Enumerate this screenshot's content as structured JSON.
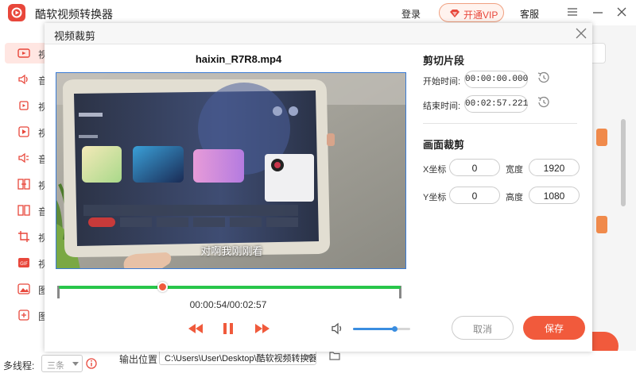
{
  "app": {
    "title": "酷软视频转换器",
    "login": "登录",
    "vip": "开通VIP",
    "service": "客服"
  },
  "sidebar": {
    "items": [
      {
        "label": "视",
        "icon": "video-icon"
      },
      {
        "label": "音",
        "icon": "audio-icon"
      },
      {
        "label": "视",
        "icon": "video-rotate-icon"
      },
      {
        "label": "视",
        "icon": "video-edit-icon"
      },
      {
        "label": "音",
        "icon": "audio-edit-icon"
      },
      {
        "label": "视",
        "icon": "merge-icon"
      },
      {
        "label": "音",
        "icon": "audio-merge-icon"
      },
      {
        "label": "视",
        "icon": "crop-icon"
      },
      {
        "label": "视",
        "icon": "gif-icon"
      },
      {
        "label": "图",
        "icon": "image-icon"
      },
      {
        "label": "图",
        "icon": "image-compress-icon"
      }
    ]
  },
  "bottom": {
    "threads_label": "多线程:",
    "threads_value": "三条",
    "output_label": "输出位置",
    "output_path": "C:\\Users\\User\\Desktop\\酷软视频转换器"
  },
  "dialog": {
    "title": "视频裁剪",
    "filename": "haixin_R7R8.mp4",
    "subtitle": "对啊我刚刚看",
    "timecode": "00:00:54/00:02:57",
    "progress": 0.305,
    "volume": 0.72,
    "segment": {
      "title": "剪切片段",
      "start_label": "开始时间:",
      "start_value": "00:00:00.000",
      "end_label": "结束时间:",
      "end_value": "00:02:57.221"
    },
    "crop": {
      "title": "画面裁剪",
      "x_label": "X坐标",
      "x_value": "0",
      "width_label": "宽度",
      "width_value": "1920",
      "y_label": "Y坐标",
      "y_value": "0",
      "height_label": "高度",
      "height_value": "1080"
    },
    "cancel": "取消",
    "save": "保存"
  },
  "colors": {
    "accent": "#f15a3c",
    "progress": "#28c64a",
    "volume": "#3a8de0",
    "selection": "#3a7bd5"
  }
}
